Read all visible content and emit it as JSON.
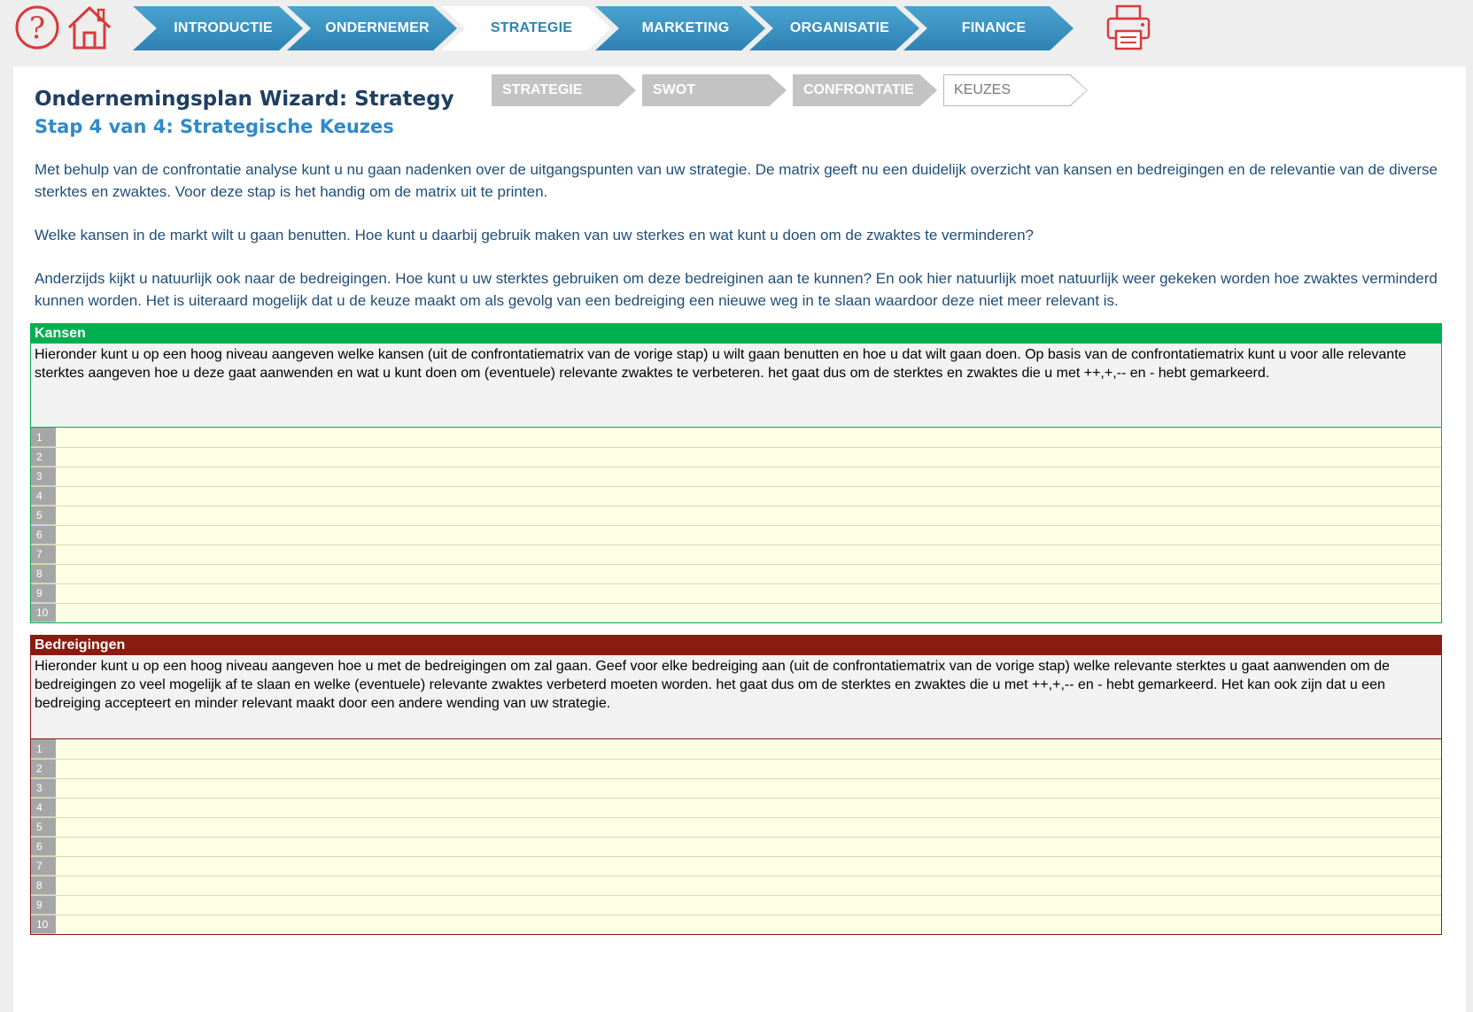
{
  "nav": {
    "tabs": [
      {
        "label": "INTRODUCTIE"
      },
      {
        "label": "ONDERNEMER"
      },
      {
        "label": "STRATEGIE",
        "active": true
      },
      {
        "label": "MARKETING"
      },
      {
        "label": "ORGANISATIE"
      },
      {
        "label": "FINANCE"
      }
    ],
    "icons": [
      "help-icon",
      "home-icon",
      "print-icon"
    ]
  },
  "colors": {
    "nav_blue": "#2e82b3",
    "title": "#1f3e62",
    "subtitle": "#2f8ac8",
    "body_text": "#1f4e79",
    "kansen_green": "#00b050",
    "bedreigingen_red": "#8b1a10",
    "input_bg": "#ffffe6"
  },
  "header": {
    "title": "Ondernemingsplan Wizard: Strategy",
    "subtitle": "Stap 4 van 4: Strategische Keuzes"
  },
  "steps": [
    {
      "label": "STRATEGIE"
    },
    {
      "label": "SWOT"
    },
    {
      "label": "CONFRONTATIE"
    },
    {
      "label": "KEUZES",
      "current": true
    }
  ],
  "intro": {
    "p1": "Met behulp van de confrontatie analyse kunt u nu gaan nadenken over de uitgangspunten van uw strategie. De matrix geeft nu een duidelijk overzicht van kansen en bedreigingen en de relevantie van de diverse sterktes en zwaktes. Voor deze stap is het handig om de matrix uit te printen.",
    "p2": "Welke kansen in de markt wilt u gaan benutten. Hoe kunt u daarbij gebruik maken van uw sterkes en wat kunt u doen om de zwaktes te verminderen?",
    "p3": "Anderzijds kijkt u natuurlijk ook naar de bedreigingen. Hoe kunt u uw sterktes gebruiken om deze bedreiginen aan te kunnen? En ook hier natuurlijk moet natuurlijk weer gekeken worden hoe zwaktes verminderd kunnen worden. Het is uiteraard mogelijk dat u de keuze maakt om als gevolg van een bedreiging een nieuwe weg in te slaan waardoor deze niet meer relevant is."
  },
  "kansen": {
    "heading": "Kansen",
    "description": "Hieronder kunt u op een hoog niveau aangeven welke kansen (uit de confrontatiematrix van de vorige stap) u wilt gaan benutten en hoe u dat wilt gaan doen. Op basis van de confrontatiematrix kunt u voor alle relevante sterktes aangeven hoe u deze gaat aanwenden en wat u kunt doen om (eventuele) relevante zwaktes te verbeteren. het gaat dus om de sterktes en zwaktes die u met ++,+,-- en - hebt gemarkeerd.",
    "rows": [
      "1",
      "2",
      "3",
      "4",
      "5",
      "6",
      "7",
      "8",
      "9",
      "10"
    ]
  },
  "bedreigingen": {
    "heading": "Bedreigingen",
    "description": "Hieronder kunt u op een hoog niveau aangeven hoe u met de bedreigingen om zal gaan. Geef voor elke bedreiging aan (uit de confrontatiematrix van de vorige stap) welke relevante sterktes u gaat aanwenden om de bedreigingen zo veel mogelijk af te slaan en welke (eventuele) relevante zwaktes verbeterd moeten worden. het gaat dus om de sterktes en zwaktes die u met ++,+,-- en - hebt gemarkeerd. Het kan ook zijn dat u een bedreiging accepteert en minder relevant maakt door een andere wending van uw strategie.",
    "rows": [
      "1",
      "2",
      "3",
      "4",
      "5",
      "6",
      "7",
      "8",
      "9",
      "10"
    ]
  }
}
